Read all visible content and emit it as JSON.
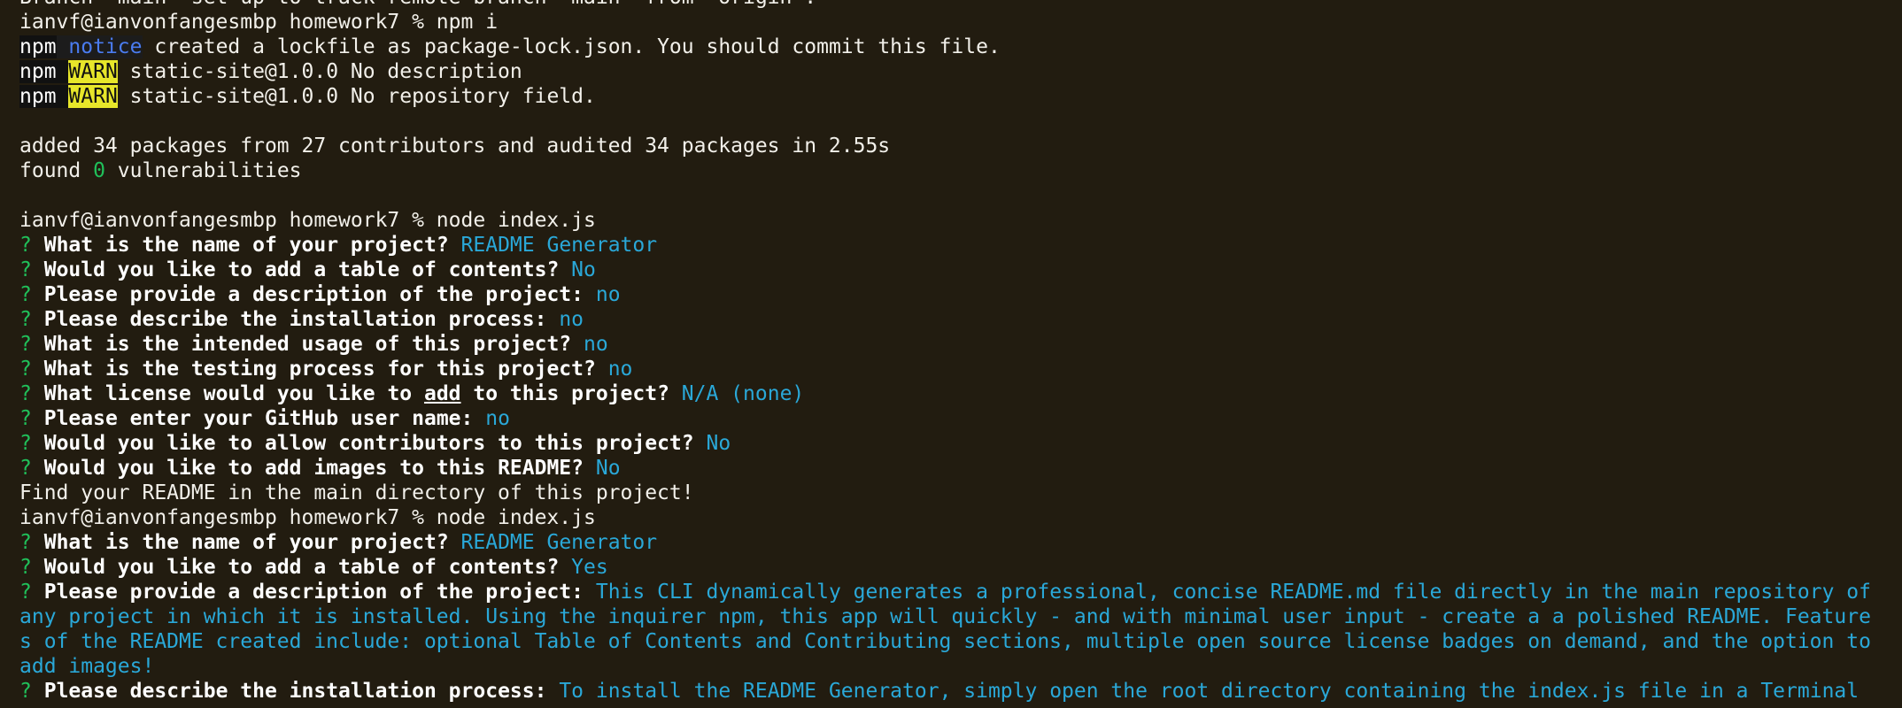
{
  "colors": {
    "background": "#221c10",
    "text": "#f2f0ea",
    "question_mark": "#20c05a",
    "answer": "#2aa8d8",
    "notice": "#4a7cf0",
    "warn_bg": "#e7e62a"
  },
  "terminal": {
    "branch_line": "Branch 'main' set up to track remote branch 'main' from 'origin'.",
    "prompt1": "ianvf@ianvonfangesmbp homework7 % npm i",
    "npm_label": "npm",
    "notice_label": "notice",
    "notice_text": " created a lockfile as package-lock.json. You should commit this file.",
    "warn_label": "WARN",
    "warn1_text": " static-site@1.0.0 No description",
    "warn2_text": " static-site@1.0.0 No repository field.",
    "added_line": "added 34 packages from 27 contributors and audited 34 packages in 2.55s",
    "found_prefix": "found ",
    "found_count": "0",
    "found_suffix": " vulnerabilities",
    "prompt2": "ianvf@ianvonfangesmbp homework7 % node index.js",
    "q_mark": "?",
    "session1": {
      "q1": "What is the name of your project?",
      "a1": "README Generator",
      "q2": "Would you like to add a table of contents?",
      "a2": "No",
      "q3": "Please provide a description of the project:",
      "a3": "no",
      "q4": "Please describe the installation process:",
      "a4": "no",
      "q5": "What is the intended usage of this project?",
      "a5": "no",
      "q6": "What is the testing process for this project?",
      "a6": "no",
      "q7_before": "What license would you like to ",
      "q7_underlined": "add",
      "q7_after": " to this project?",
      "a7": "N/A (none)",
      "q8": "Please enter your GitHub user name:",
      "a8": "no",
      "q9": "Would you like to allow contributors to this project?",
      "a9": "No",
      "q10": "Would you like to add images to this README?",
      "a10": "No"
    },
    "find_line": "Find your README in the main directory of this project!",
    "prompt3": "ianvf@ianvonfangesmbp homework7 % node index.js",
    "session2": {
      "q1": "What is the name of your project?",
      "a1": "README Generator",
      "q2": "Would you like to add a table of contents?",
      "a2": "Yes",
      "q3": "Please provide a description of the project:",
      "a3": "This CLI dynamically generates a professional, concise README.md file directly in the main repository of any project in which it is installed. Using the inquirer npm, this app will quickly - and with minimal user input - create a a polished README. Features of the README created include: optional Table of Contents and Contributing sections, multiple open source license badges on demand, and the option to add images!",
      "q4": "Please describe the installation process:",
      "a4": "To install the README Generator, simply open the root directory containing the index.js file in a Terminal"
    }
  }
}
